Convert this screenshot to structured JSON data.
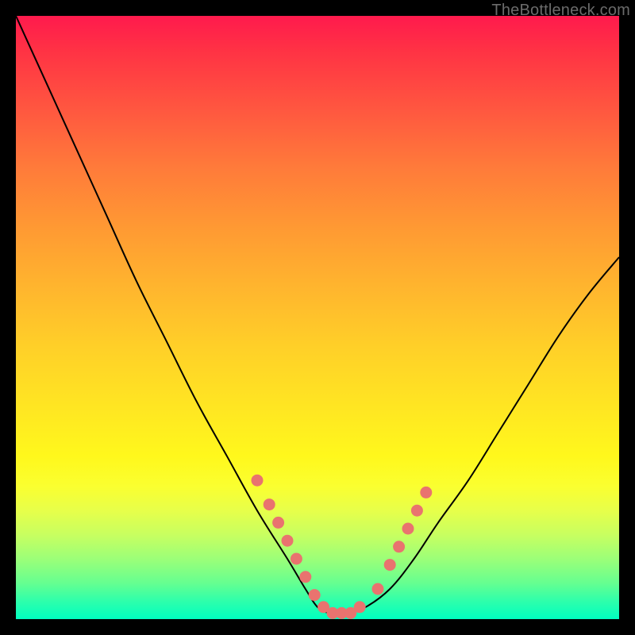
{
  "watermark": "TheBottleneck.com",
  "chart_data": {
    "type": "line",
    "title": "",
    "xlabel": "",
    "ylabel": "",
    "xlim": [
      0,
      100
    ],
    "ylim": [
      0,
      100
    ],
    "grid": false,
    "legend": false,
    "background_gradient": {
      "orientation": "vertical",
      "stops": [
        {
          "pos": 0,
          "color": "#ff1a4d"
        },
        {
          "pos": 25,
          "color": "#ff7a3a"
        },
        {
          "pos": 50,
          "color": "#ffc828"
        },
        {
          "pos": 75,
          "color": "#f5ff30"
        },
        {
          "pos": 100,
          "color": "#00ffc0"
        }
      ]
    },
    "series": [
      {
        "name": "curve",
        "stroke": "#000000",
        "x": [
          0,
          5,
          10,
          15,
          20,
          25,
          30,
          35,
          40,
          45,
          48,
          50,
          52,
          55,
          58,
          62,
          66,
          70,
          75,
          80,
          85,
          90,
          95,
          100
        ],
        "y": [
          100,
          89,
          78,
          67,
          56,
          46,
          36,
          27,
          18,
          10,
          5,
          2,
          1,
          1,
          2,
          5,
          10,
          16,
          23,
          31,
          39,
          47,
          54,
          60
        ]
      }
    ],
    "markers": {
      "name": "highlight-dots",
      "fill": "#e9736f",
      "x": [
        40,
        42,
        43.5,
        45,
        46.5,
        48,
        49.5,
        51,
        52.5,
        54,
        55.5,
        57,
        60,
        62,
        63.5,
        65,
        66.5,
        68
      ],
      "y": [
        23,
        19,
        16,
        13,
        10,
        7,
        4,
        2,
        1,
        1,
        1,
        2,
        5,
        9,
        12,
        15,
        18,
        21
      ]
    },
    "green_band": {
      "y_range": [
        0,
        4
      ],
      "color_hint": "#00ffc0"
    }
  }
}
